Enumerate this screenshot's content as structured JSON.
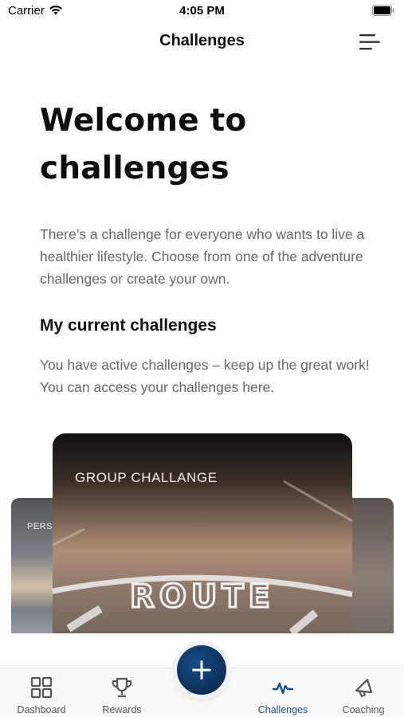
{
  "status_bar": {
    "carrier": "Carrier",
    "time": "4:05 PM",
    "icons": [
      "wifi-icon",
      "battery-icon"
    ]
  },
  "nav": {
    "title": "Challenges",
    "menu_icon": "menu-icon"
  },
  "main": {
    "welcome_title_line1": "Welcome to",
    "welcome_title_line2": "challenges",
    "intro": "There’s a challenge for everyone who wants to live a healthier lifestyle. Choose from one of the adventure challenges or create your own.",
    "section_heading": "My current challenges",
    "section_text": "You have active challenges – keep up the great work!  You can access your challenges here."
  },
  "carousel": {
    "cards": [
      {
        "label": "PERSO",
        "position": "left"
      },
      {
        "label": "GROUP CHALLANGE",
        "position": "center",
        "image_text": "ROUTE"
      },
      {
        "label": "",
        "position": "right"
      }
    ]
  },
  "fab": {
    "icon": "plus-icon",
    "color": "#0a2f58"
  },
  "tabs": [
    {
      "label": "Dashboard",
      "icon": "grid-icon",
      "active": false
    },
    {
      "label": "Rewards",
      "icon": "trophy-icon",
      "active": false
    },
    {
      "label": "Challenges",
      "icon": "activity-icon",
      "active": true
    },
    {
      "label": "Coaching",
      "icon": "megaphone-icon",
      "active": false
    }
  ],
  "colors": {
    "accent": "#1a4f86",
    "text_primary": "#111111",
    "text_secondary": "#666666",
    "tab_inactive": "#555555"
  }
}
